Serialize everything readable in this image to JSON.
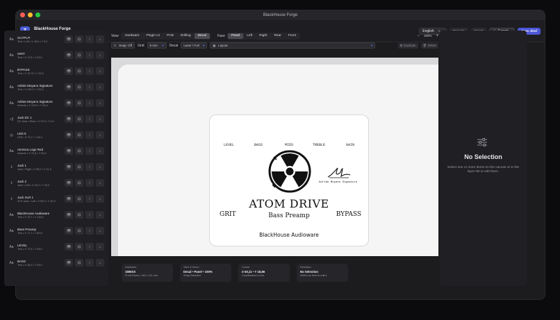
{
  "window": {
    "title": "BlackHouse Forge"
  },
  "header": {
    "logo": "T",
    "project_name": "BlackHouse Forge",
    "project_sub": "Atom Drive • Pedal • 1590XX • 145 × 121 × 40 mm",
    "language": "English",
    "projects_label": "Projects",
    "import_label": "Import",
    "export_label": "Export",
    "save_label": "Save .bhsf"
  },
  "layers": [
    {
      "icon": "Aa",
      "name": "OUTPUT",
      "meta": "Text • Left • X 45,0 • Y 9,0"
    },
    {
      "icon": "Aa",
      "name": "GRIT",
      "meta": "Text • X 17,5 • Y 92,0"
    },
    {
      "icon": "Aa",
      "name": "BYPASS",
      "meta": "Text • X 127,5 • Y 92,0"
    },
    {
      "icon": "Aa",
      "name": "Adrián Moyano Signature",
      "meta": "Text • X 120,0 • Y 62,4"
    },
    {
      "icon": "Aa",
      "name": "Adrian Moyano Signature",
      "meta": "Artwork • X 120,0 • Y 54,0"
    },
    {
      "icon": "◁)",
      "name": "Jack DC 1",
      "meta": "DC Jack • Rear • X 72,5 • Y 0,0"
    },
    {
      "icon": "◎",
      "name": "LED 6",
      "meta": "LED • X 72,7 • Y 62,2"
    },
    {
      "icon": "Aa",
      "name": "Atomica Logo Red",
      "meta": "Artwork • X 72,8 • Y 53,0"
    },
    {
      "icon": "⫰",
      "name": "Jack 1",
      "meta": "Jack • Right • X 95,0 • Y 21,0"
    },
    {
      "icon": "⫰",
      "name": "Jack 2",
      "meta": "Jack • Left • X 40,0 • Y 20,0"
    },
    {
      "icon": "⫰",
      "name": "Jack XLR 1",
      "meta": "XLR Jack • Left • X 63,0 • Y 20,0"
    },
    {
      "icon": "Aa",
      "name": "BlackHouse Audioware",
      "meta": "Text • X 72,7 • Y 110,0"
    },
    {
      "icon": "Aa",
      "name": "Bass Preamp",
      "meta": "Text • X 71,7 • Y 80,5"
    },
    {
      "icon": "Aa",
      "name": "LEVEL",
      "meta": "Text • X 17,5 • Y 28,0"
    },
    {
      "icon": "Aa",
      "name": "BASS",
      "meta": "Text • X 45,0 • Y 28,0"
    }
  ],
  "layer_buttons": {
    "visibility": "👁",
    "lock": "⊡",
    "up": "↑",
    "down": "↓"
  },
  "toolbar": {
    "view_label": "View",
    "view_tabs": [
      "Hardware",
      "Plugin UI",
      "PCB",
      "Drilling",
      "Decal"
    ],
    "view_active": "Decal",
    "face_label": "Face",
    "face_tabs": [
      "Panel",
      "Left",
      "Right",
      "Rear",
      "Front"
    ],
    "face_active": "Panel",
    "zoom_out": "−",
    "zoom": "100%",
    "zoom_in": "+",
    "snap": "Snap: Off",
    "grid_label": "Grid",
    "grid_value": "5 mm",
    "decal_label": "Decal",
    "decal_value": "Laser / Foil",
    "layout_value": "Layout",
    "duplicate": "Duplicate",
    "delete": "Delete"
  },
  "pedal": {
    "knobs": [
      "LEVEL",
      "BASS",
      "MIDS",
      "TREBLE",
      "GAIN"
    ],
    "title": "ATOM DRIVE",
    "subtitle": "Bass Preamp",
    "grit": "GRIT",
    "bypass": "BYPASS",
    "brand": "BlackHouse Audioware",
    "signature_text": "Adrián Moyano Signature"
  },
  "status": [
    {
      "label": "Hardware",
      "value": "1590XX",
      "note": "Front Panel • 145 x 121 mm"
    },
    {
      "label": "View & Zoom",
      "value": "Decal • Panel • 100%",
      "note": "Snap Disabled"
    },
    {
      "label": "Cursor",
      "value": "X 50,11 • Y 18,86",
      "note": "Coordinates in mm"
    },
    {
      "label": "Selection",
      "value": "No Selection",
      "note": "Select an item to edit it"
    }
  ],
  "inspector": {
    "title": "No Selection",
    "message": "Select one or more items on the canvas or in the layer list to edit them."
  }
}
